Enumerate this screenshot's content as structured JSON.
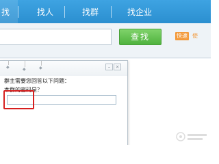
{
  "nav": {
    "tabs": [
      {
        "label": "找",
        "active": true
      },
      {
        "label": "找人",
        "active": false
      },
      {
        "label": "找群",
        "active": false
      },
      {
        "label": "找企业",
        "active": false
      }
    ]
  },
  "search": {
    "button_label": "查找",
    "quick_badge": "快速",
    "quick_text": "使"
  },
  "dialog": {
    "prompt": "群主需要您回答以下问题：",
    "question": "本群的密码是？",
    "answer_value": ""
  },
  "colors": {
    "nav_bg": "#2b8fd0",
    "search_button": "#4fb23e",
    "highlight": "#d61e1e",
    "badge": "#f39a3b"
  }
}
